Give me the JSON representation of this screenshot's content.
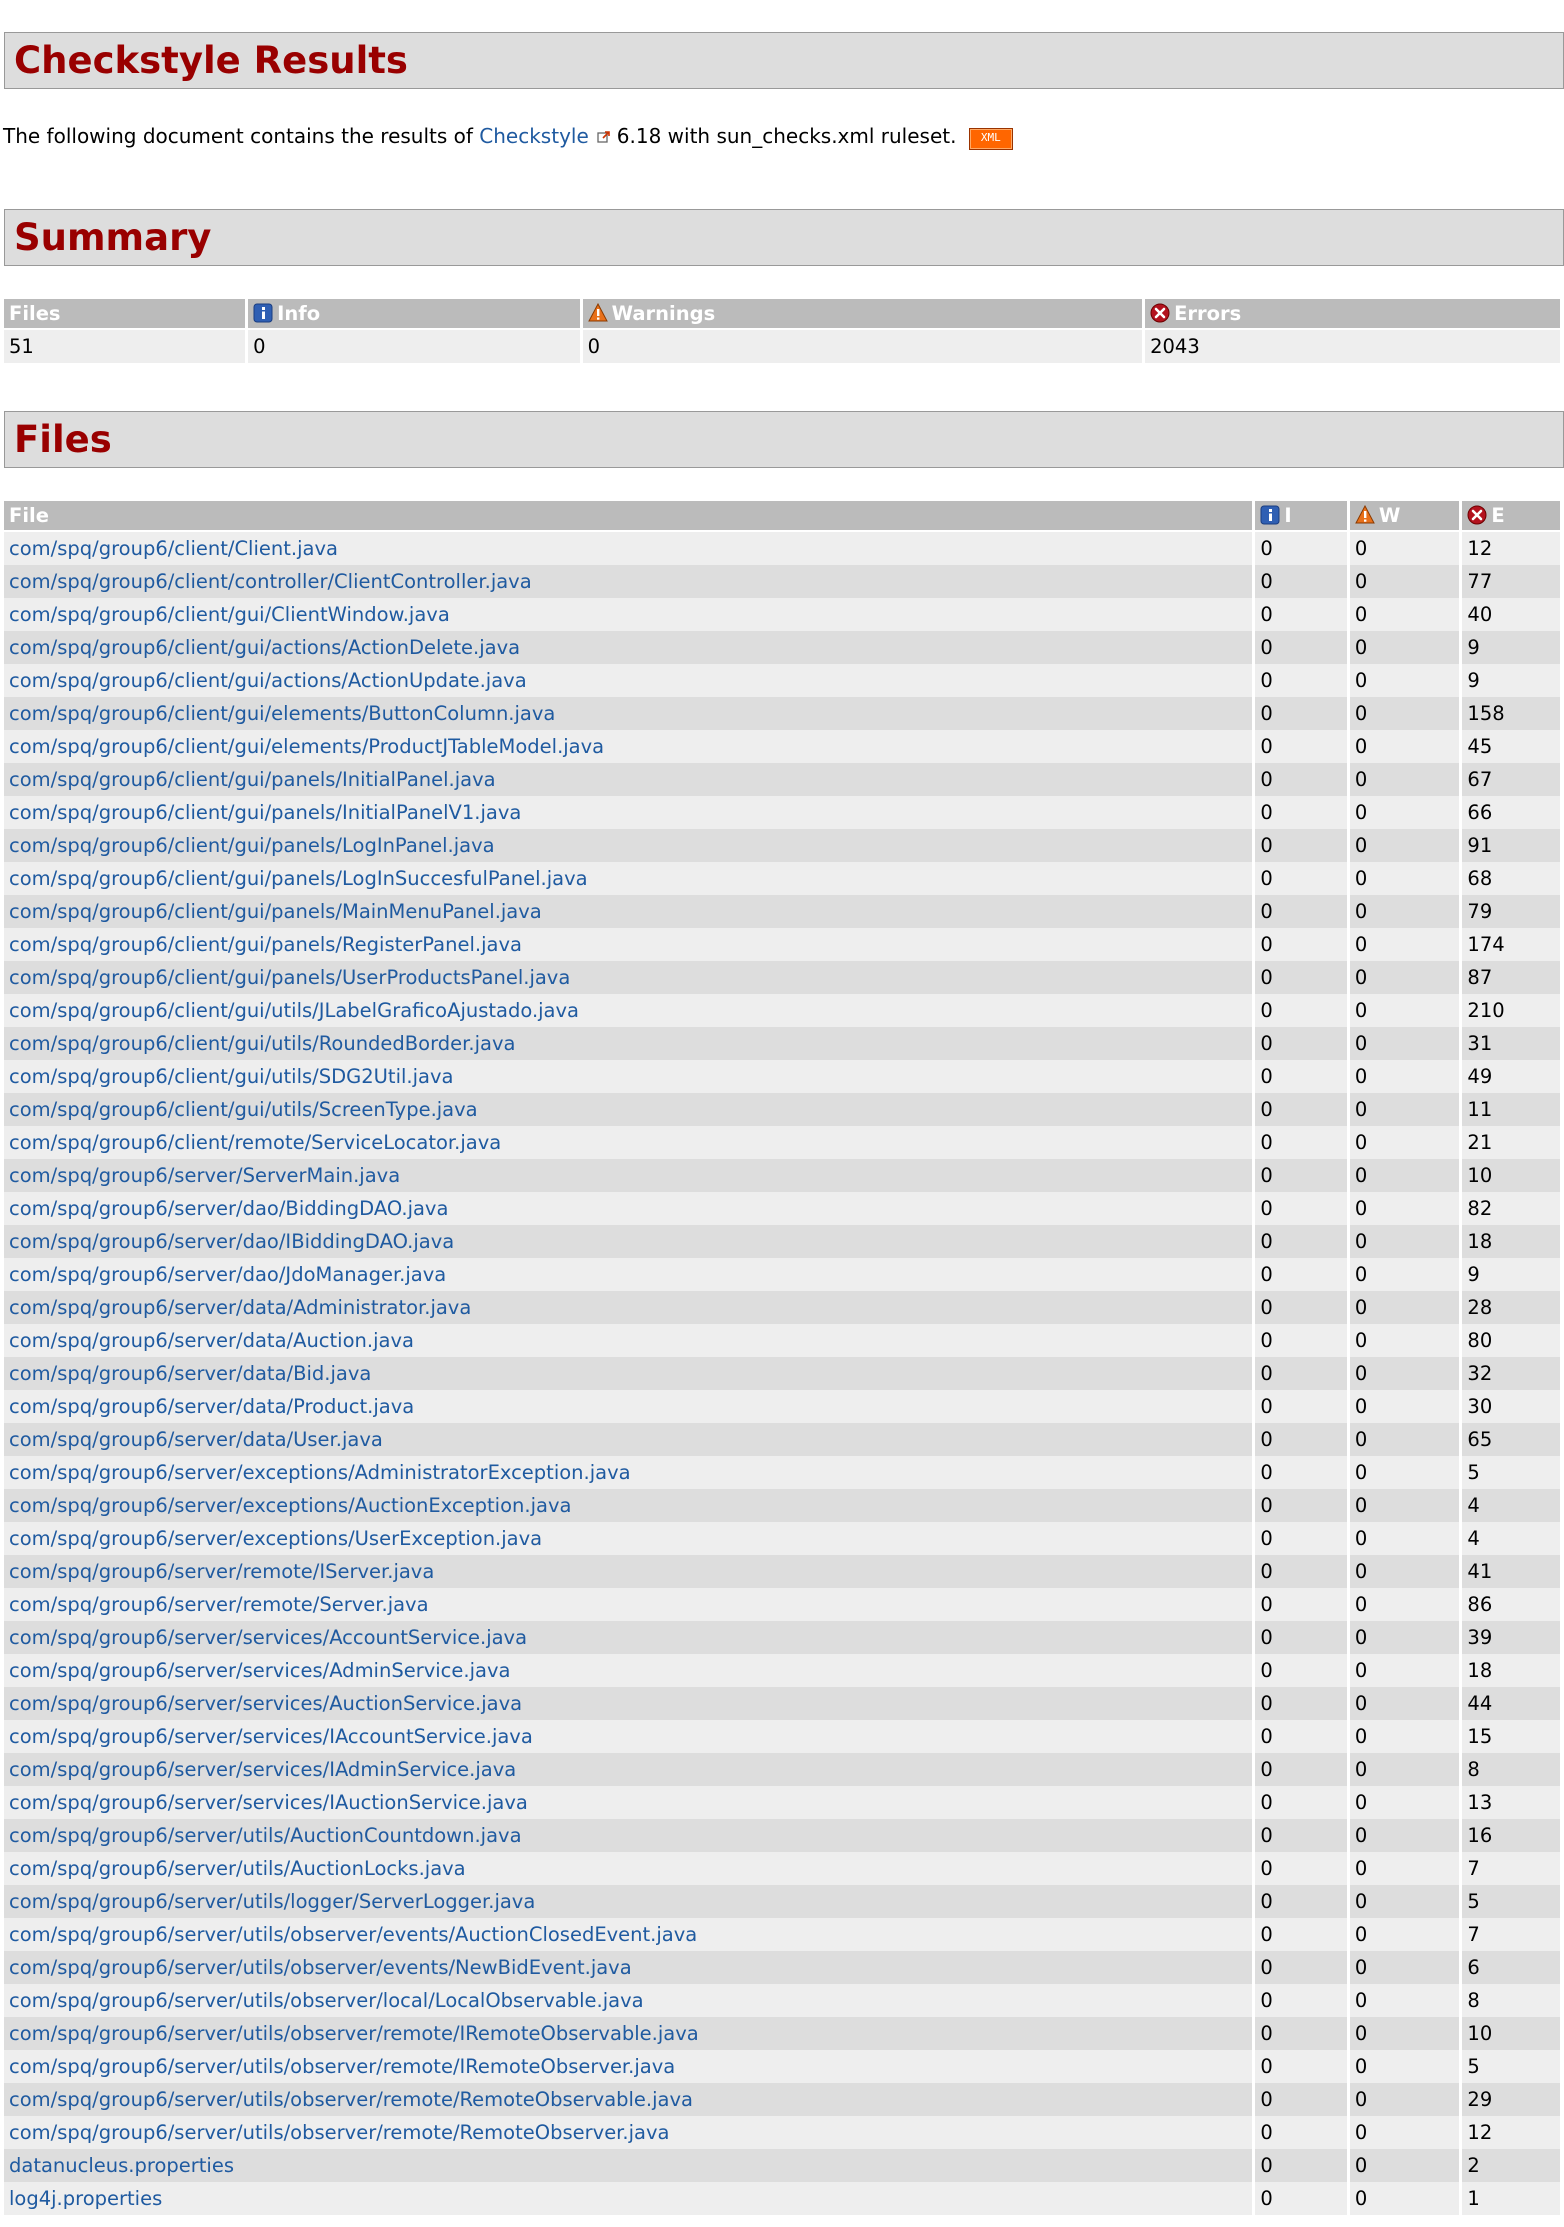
{
  "results_header": "Checkstyle Results",
  "intro": {
    "prefix": "The following document contains the results of",
    "link_text": "Checkstyle",
    "suffix": "6.18 with sun_checks.xml ruleset.",
    "xml_badge": "XML"
  },
  "summary": {
    "header": "Summary",
    "columns": [
      "Files",
      "Info",
      "Warnings",
      "Errors"
    ],
    "values": [
      "51",
      "0",
      "0",
      "2043"
    ]
  },
  "files": {
    "header": "Files",
    "columns": [
      "File",
      "I",
      "W",
      "E"
    ],
    "rows": [
      {
        "file": "com/spq/group6/client/Client.java",
        "i": "0",
        "w": "0",
        "e": "12"
      },
      {
        "file": "com/spq/group6/client/controller/ClientController.java",
        "i": "0",
        "w": "0",
        "e": "77"
      },
      {
        "file": "com/spq/group6/client/gui/ClientWindow.java",
        "i": "0",
        "w": "0",
        "e": "40"
      },
      {
        "file": "com/spq/group6/client/gui/actions/ActionDelete.java",
        "i": "0",
        "w": "0",
        "e": "9"
      },
      {
        "file": "com/spq/group6/client/gui/actions/ActionUpdate.java",
        "i": "0",
        "w": "0",
        "e": "9"
      },
      {
        "file": "com/spq/group6/client/gui/elements/ButtonColumn.java",
        "i": "0",
        "w": "0",
        "e": "158"
      },
      {
        "file": "com/spq/group6/client/gui/elements/ProductJTableModel.java",
        "i": "0",
        "w": "0",
        "e": "45"
      },
      {
        "file": "com/spq/group6/client/gui/panels/InitialPanel.java",
        "i": "0",
        "w": "0",
        "e": "67"
      },
      {
        "file": "com/spq/group6/client/gui/panels/InitialPanelV1.java",
        "i": "0",
        "w": "0",
        "e": "66"
      },
      {
        "file": "com/spq/group6/client/gui/panels/LogInPanel.java",
        "i": "0",
        "w": "0",
        "e": "91"
      },
      {
        "file": "com/spq/group6/client/gui/panels/LogInSuccesfulPanel.java",
        "i": "0",
        "w": "0",
        "e": "68"
      },
      {
        "file": "com/spq/group6/client/gui/panels/MainMenuPanel.java",
        "i": "0",
        "w": "0",
        "e": "79"
      },
      {
        "file": "com/spq/group6/client/gui/panels/RegisterPanel.java",
        "i": "0",
        "w": "0",
        "e": "174"
      },
      {
        "file": "com/spq/group6/client/gui/panels/UserProductsPanel.java",
        "i": "0",
        "w": "0",
        "e": "87"
      },
      {
        "file": "com/spq/group6/client/gui/utils/JLabelGraficoAjustado.java",
        "i": "0",
        "w": "0",
        "e": "210"
      },
      {
        "file": "com/spq/group6/client/gui/utils/RoundedBorder.java",
        "i": "0",
        "w": "0",
        "e": "31"
      },
      {
        "file": "com/spq/group6/client/gui/utils/SDG2Util.java",
        "i": "0",
        "w": "0",
        "e": "49"
      },
      {
        "file": "com/spq/group6/client/gui/utils/ScreenType.java",
        "i": "0",
        "w": "0",
        "e": "11"
      },
      {
        "file": "com/spq/group6/client/remote/ServiceLocator.java",
        "i": "0",
        "w": "0",
        "e": "21"
      },
      {
        "file": "com/spq/group6/server/ServerMain.java",
        "i": "0",
        "w": "0",
        "e": "10"
      },
      {
        "file": "com/spq/group6/server/dao/BiddingDAO.java",
        "i": "0",
        "w": "0",
        "e": "82"
      },
      {
        "file": "com/spq/group6/server/dao/IBiddingDAO.java",
        "i": "0",
        "w": "0",
        "e": "18"
      },
      {
        "file": "com/spq/group6/server/dao/JdoManager.java",
        "i": "0",
        "w": "0",
        "e": "9"
      },
      {
        "file": "com/spq/group6/server/data/Administrator.java",
        "i": "0",
        "w": "0",
        "e": "28"
      },
      {
        "file": "com/spq/group6/server/data/Auction.java",
        "i": "0",
        "w": "0",
        "e": "80"
      },
      {
        "file": "com/spq/group6/server/data/Bid.java",
        "i": "0",
        "w": "0",
        "e": "32"
      },
      {
        "file": "com/spq/group6/server/data/Product.java",
        "i": "0",
        "w": "0",
        "e": "30"
      },
      {
        "file": "com/spq/group6/server/data/User.java",
        "i": "0",
        "w": "0",
        "e": "65"
      },
      {
        "file": "com/spq/group6/server/exceptions/AdministratorException.java",
        "i": "0",
        "w": "0",
        "e": "5"
      },
      {
        "file": "com/spq/group6/server/exceptions/AuctionException.java",
        "i": "0",
        "w": "0",
        "e": "4"
      },
      {
        "file": "com/spq/group6/server/exceptions/UserException.java",
        "i": "0",
        "w": "0",
        "e": "4"
      },
      {
        "file": "com/spq/group6/server/remote/IServer.java",
        "i": "0",
        "w": "0",
        "e": "41"
      },
      {
        "file": "com/spq/group6/server/remote/Server.java",
        "i": "0",
        "w": "0",
        "e": "86"
      },
      {
        "file": "com/spq/group6/server/services/AccountService.java",
        "i": "0",
        "w": "0",
        "e": "39"
      },
      {
        "file": "com/spq/group6/server/services/AdminService.java",
        "i": "0",
        "w": "0",
        "e": "18"
      },
      {
        "file": "com/spq/group6/server/services/AuctionService.java",
        "i": "0",
        "w": "0",
        "e": "44"
      },
      {
        "file": "com/spq/group6/server/services/IAccountService.java",
        "i": "0",
        "w": "0",
        "e": "15"
      },
      {
        "file": "com/spq/group6/server/services/IAdminService.java",
        "i": "0",
        "w": "0",
        "e": "8"
      },
      {
        "file": "com/spq/group6/server/services/IAuctionService.java",
        "i": "0",
        "w": "0",
        "e": "13"
      },
      {
        "file": "com/spq/group6/server/utils/AuctionCountdown.java",
        "i": "0",
        "w": "0",
        "e": "16"
      },
      {
        "file": "com/spq/group6/server/utils/AuctionLocks.java",
        "i": "0",
        "w": "0",
        "e": "7"
      },
      {
        "file": "com/spq/group6/server/utils/logger/ServerLogger.java",
        "i": "0",
        "w": "0",
        "e": "5"
      },
      {
        "file": "com/spq/group6/server/utils/observer/events/AuctionClosedEvent.java",
        "i": "0",
        "w": "0",
        "e": "7"
      },
      {
        "file": "com/spq/group6/server/utils/observer/events/NewBidEvent.java",
        "i": "0",
        "w": "0",
        "e": "6"
      },
      {
        "file": "com/spq/group6/server/utils/observer/local/LocalObservable.java",
        "i": "0",
        "w": "0",
        "e": "8"
      },
      {
        "file": "com/spq/group6/server/utils/observer/remote/IRemoteObservable.java",
        "i": "0",
        "w": "0",
        "e": "10"
      },
      {
        "file": "com/spq/group6/server/utils/observer/remote/IRemoteObserver.java",
        "i": "0",
        "w": "0",
        "e": "5"
      },
      {
        "file": "com/spq/group6/server/utils/observer/remote/RemoteObservable.java",
        "i": "0",
        "w": "0",
        "e": "29"
      },
      {
        "file": "com/spq/group6/server/utils/observer/remote/RemoteObserver.java",
        "i": "0",
        "w": "0",
        "e": "12"
      },
      {
        "file": "datanucleus.properties",
        "i": "0",
        "w": "0",
        "e": "2"
      },
      {
        "file": "log4j.properties",
        "i": "0",
        "w": "0",
        "e": "1"
      }
    ]
  },
  "colors": {
    "header_text": "#990000",
    "header_bg": "#dddddd",
    "table_header_bg": "#bbbbbb",
    "row_light": "#eeeeee",
    "row_dark": "#dddddd",
    "link": "#1f5aa0"
  },
  "icons": {
    "info": "info-icon",
    "warning": "warning-icon",
    "error": "error-icon",
    "external": "external-link-icon",
    "xml": "xml-feed-icon"
  }
}
